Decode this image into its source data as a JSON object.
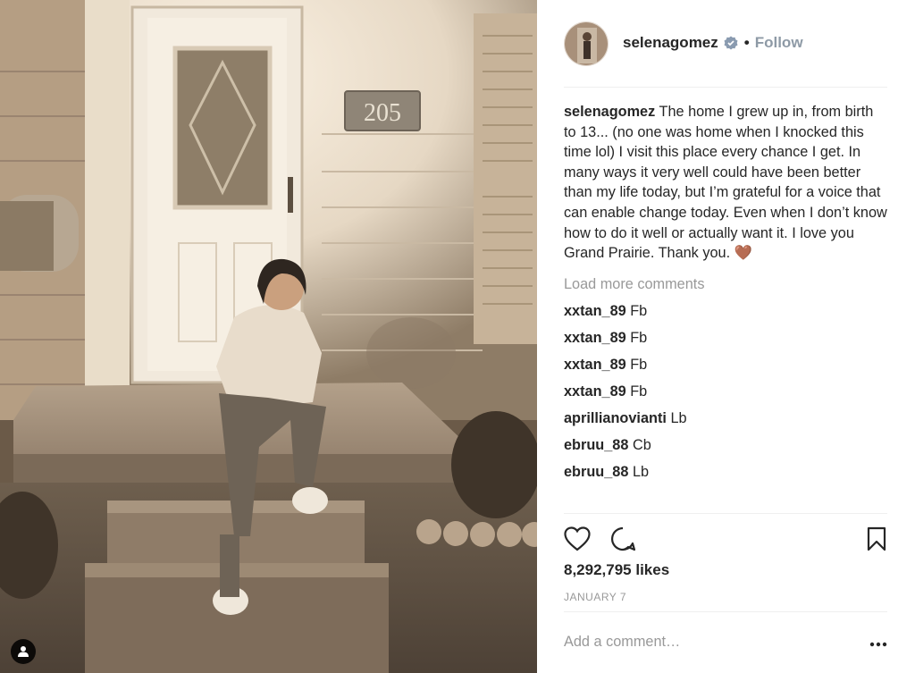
{
  "post": {
    "username": "selenagomez",
    "follow_label": "Follow",
    "separator": "•",
    "house_number": "205",
    "caption_text": " The home I grew up in, from birth to 13... (no one was home when I knocked this time lol) I visit this place every chance I get. In many ways it very well could have been better than my life today, but I’m grateful for a voice that can enable change today. Even when I don’t know how to do it well or actually want it. I love you Grand Prairie. Thank you. 🤎",
    "load_more": "Load more comments",
    "comments": [
      {
        "user": "xxtan_89",
        "text": "Fb"
      },
      {
        "user": "xxtan_89",
        "text": "Fb"
      },
      {
        "user": "xxtan_89",
        "text": "Fb"
      },
      {
        "user": "xxtan_89",
        "text": "Fb"
      },
      {
        "user": "aprillianovianti",
        "text": "Lb"
      },
      {
        "user": "ebruu_88",
        "text": "Cb"
      },
      {
        "user": "ebruu_88",
        "text": "Lb"
      }
    ],
    "likes": "8,292,795 likes",
    "date": "JANUARY 7",
    "comment_placeholder": "Add a comment…"
  },
  "icons": {
    "verified": "verified-badge-icon",
    "like": "heart-icon",
    "comment": "comment-bubble-icon",
    "save": "bookmark-icon",
    "more": "more-options-icon",
    "user_tag": "user-tag-icon"
  },
  "colors": {
    "follow": "#8e9aa6",
    "muted": "#999999",
    "text": "#262626",
    "verified": "#8a9bb0"
  }
}
